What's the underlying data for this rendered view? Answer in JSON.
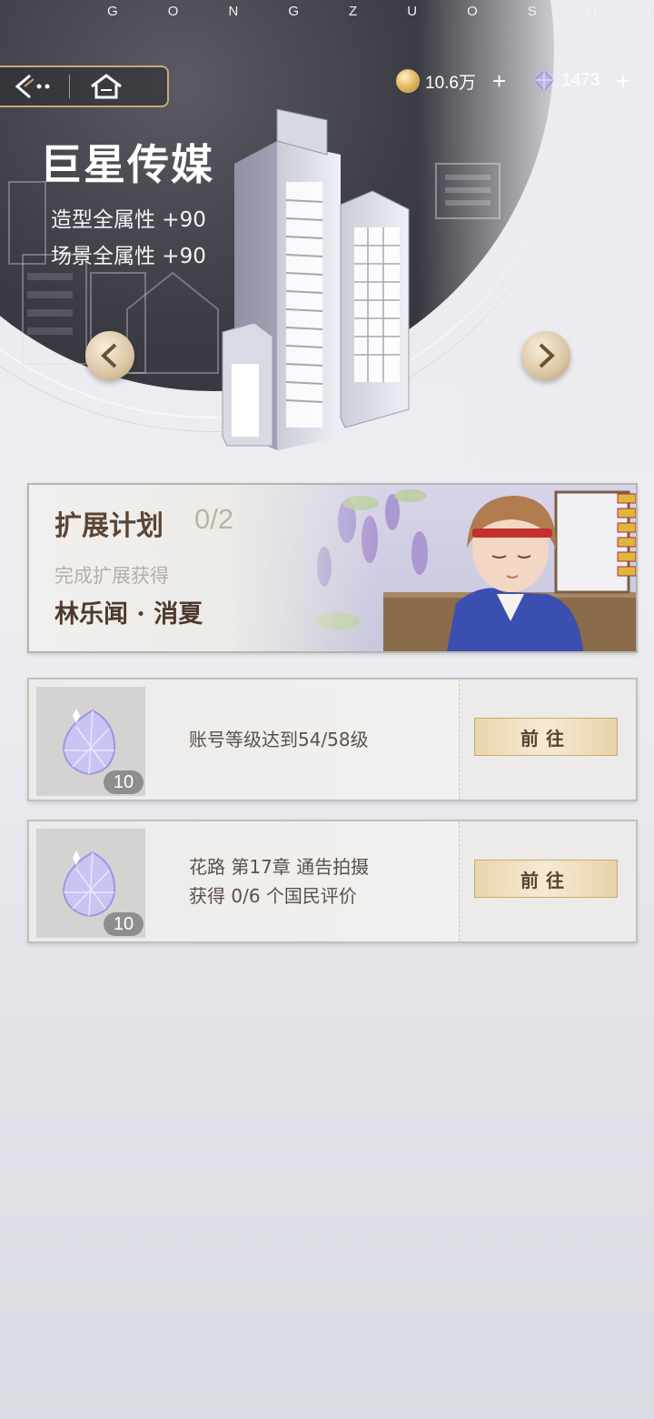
{
  "header": {
    "top_letters": [
      "G",
      "O",
      "N",
      "G",
      "Z",
      "U",
      "O",
      "S",
      "H",
      "I"
    ],
    "nav": {
      "back_icon": "back-arrow-icon",
      "home_icon": "home-icon"
    },
    "currencies": [
      {
        "icon": "gold-coin-icon",
        "value": "10.6万",
        "plus": "+"
      },
      {
        "icon": "diamond-icon",
        "value": "1473",
        "plus": "+"
      }
    ]
  },
  "company": {
    "name": "巨星传媒",
    "attributes": [
      "造型全属性 +90",
      "场景全属性 +90"
    ]
  },
  "plan": {
    "title": "扩展计划",
    "progress": "0/2",
    "subtitle": "完成扩展获得",
    "reward": "林乐闻 · 消夏"
  },
  "tasks": [
    {
      "reward_icon": "diamond-icon",
      "reward_count": "10",
      "lines": [
        "账号等级达到54/58级"
      ],
      "button": "前往"
    },
    {
      "reward_icon": "diamond-icon",
      "reward_count": "10",
      "lines": [
        "花路 第17章 通告拍摄",
        "获得 0/6 个国民评价"
      ],
      "button": "前往"
    }
  ],
  "colors": {
    "accent_gold": "#c9a87a",
    "title_brown": "#5a4536",
    "background": "#eeeef2"
  }
}
